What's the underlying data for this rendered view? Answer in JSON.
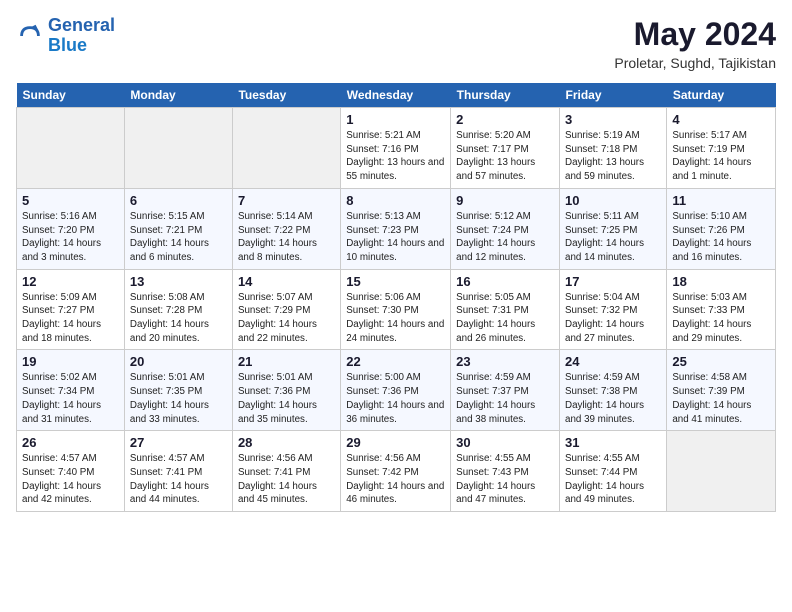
{
  "header": {
    "logo_line1": "General",
    "logo_line2": "Blue",
    "month_year": "May 2024",
    "location": "Proletar, Sughd, Tajikistan"
  },
  "days_of_week": [
    "Sunday",
    "Monday",
    "Tuesday",
    "Wednesday",
    "Thursday",
    "Friday",
    "Saturday"
  ],
  "weeks": [
    [
      {
        "day": "",
        "empty": true
      },
      {
        "day": "",
        "empty": true
      },
      {
        "day": "",
        "empty": true
      },
      {
        "day": "1",
        "sunrise": "5:21 AM",
        "sunset": "7:16 PM",
        "daylight": "13 hours and 55 minutes."
      },
      {
        "day": "2",
        "sunrise": "5:20 AM",
        "sunset": "7:17 PM",
        "daylight": "13 hours and 57 minutes."
      },
      {
        "day": "3",
        "sunrise": "5:19 AM",
        "sunset": "7:18 PM",
        "daylight": "13 hours and 59 minutes."
      },
      {
        "day": "4",
        "sunrise": "5:17 AM",
        "sunset": "7:19 PM",
        "daylight": "14 hours and 1 minute."
      }
    ],
    [
      {
        "day": "5",
        "sunrise": "5:16 AM",
        "sunset": "7:20 PM",
        "daylight": "14 hours and 3 minutes."
      },
      {
        "day": "6",
        "sunrise": "5:15 AM",
        "sunset": "7:21 PM",
        "daylight": "14 hours and 6 minutes."
      },
      {
        "day": "7",
        "sunrise": "5:14 AM",
        "sunset": "7:22 PM",
        "daylight": "14 hours and 8 minutes."
      },
      {
        "day": "8",
        "sunrise": "5:13 AM",
        "sunset": "7:23 PM",
        "daylight": "14 hours and 10 minutes."
      },
      {
        "day": "9",
        "sunrise": "5:12 AM",
        "sunset": "7:24 PM",
        "daylight": "14 hours and 12 minutes."
      },
      {
        "day": "10",
        "sunrise": "5:11 AM",
        "sunset": "7:25 PM",
        "daylight": "14 hours and 14 minutes."
      },
      {
        "day": "11",
        "sunrise": "5:10 AM",
        "sunset": "7:26 PM",
        "daylight": "14 hours and 16 minutes."
      }
    ],
    [
      {
        "day": "12",
        "sunrise": "5:09 AM",
        "sunset": "7:27 PM",
        "daylight": "14 hours and 18 minutes."
      },
      {
        "day": "13",
        "sunrise": "5:08 AM",
        "sunset": "7:28 PM",
        "daylight": "14 hours and 20 minutes."
      },
      {
        "day": "14",
        "sunrise": "5:07 AM",
        "sunset": "7:29 PM",
        "daylight": "14 hours and 22 minutes."
      },
      {
        "day": "15",
        "sunrise": "5:06 AM",
        "sunset": "7:30 PM",
        "daylight": "14 hours and 24 minutes."
      },
      {
        "day": "16",
        "sunrise": "5:05 AM",
        "sunset": "7:31 PM",
        "daylight": "14 hours and 26 minutes."
      },
      {
        "day": "17",
        "sunrise": "5:04 AM",
        "sunset": "7:32 PM",
        "daylight": "14 hours and 27 minutes."
      },
      {
        "day": "18",
        "sunrise": "5:03 AM",
        "sunset": "7:33 PM",
        "daylight": "14 hours and 29 minutes."
      }
    ],
    [
      {
        "day": "19",
        "sunrise": "5:02 AM",
        "sunset": "7:34 PM",
        "daylight": "14 hours and 31 minutes."
      },
      {
        "day": "20",
        "sunrise": "5:01 AM",
        "sunset": "7:35 PM",
        "daylight": "14 hours and 33 minutes."
      },
      {
        "day": "21",
        "sunrise": "5:01 AM",
        "sunset": "7:36 PM",
        "daylight": "14 hours and 35 minutes."
      },
      {
        "day": "22",
        "sunrise": "5:00 AM",
        "sunset": "7:36 PM",
        "daylight": "14 hours and 36 minutes."
      },
      {
        "day": "23",
        "sunrise": "4:59 AM",
        "sunset": "7:37 PM",
        "daylight": "14 hours and 38 minutes."
      },
      {
        "day": "24",
        "sunrise": "4:59 AM",
        "sunset": "7:38 PM",
        "daylight": "14 hours and 39 minutes."
      },
      {
        "day": "25",
        "sunrise": "4:58 AM",
        "sunset": "7:39 PM",
        "daylight": "14 hours and 41 minutes."
      }
    ],
    [
      {
        "day": "26",
        "sunrise": "4:57 AM",
        "sunset": "7:40 PM",
        "daylight": "14 hours and 42 minutes."
      },
      {
        "day": "27",
        "sunrise": "4:57 AM",
        "sunset": "7:41 PM",
        "daylight": "14 hours and 44 minutes."
      },
      {
        "day": "28",
        "sunrise": "4:56 AM",
        "sunset": "7:41 PM",
        "daylight": "14 hours and 45 minutes."
      },
      {
        "day": "29",
        "sunrise": "4:56 AM",
        "sunset": "7:42 PM",
        "daylight": "14 hours and 46 minutes."
      },
      {
        "day": "30",
        "sunrise": "4:55 AM",
        "sunset": "7:43 PM",
        "daylight": "14 hours and 47 minutes."
      },
      {
        "day": "31",
        "sunrise": "4:55 AM",
        "sunset": "7:44 PM",
        "daylight": "14 hours and 49 minutes."
      },
      {
        "day": "",
        "empty": true
      }
    ]
  ]
}
